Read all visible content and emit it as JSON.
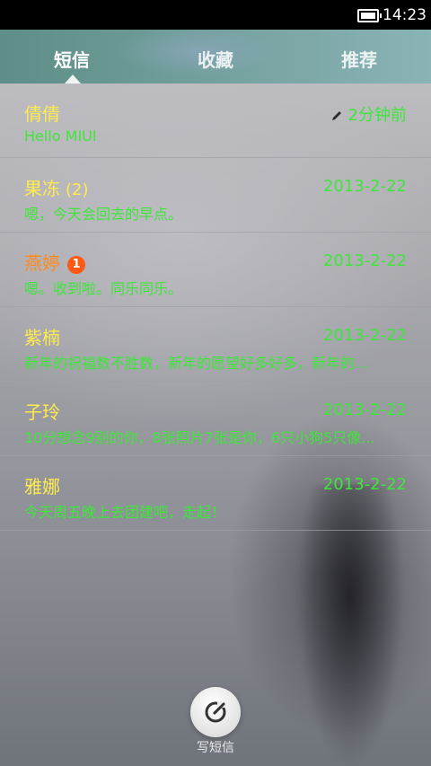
{
  "status_bar": {
    "time": "14:23"
  },
  "tabs": [
    {
      "label": "短信"
    },
    {
      "label": "收藏"
    },
    {
      "label": "推荐"
    }
  ],
  "messages": [
    {
      "name": "倩倩",
      "date": "2分钟前",
      "preview": "Hello MIUI"
    },
    {
      "name": "果冻",
      "count": "(2)",
      "date": "2013-2-22",
      "preview": "嗯，今天会回去的早点。"
    },
    {
      "name": "燕婷",
      "unread": "1",
      "date": "2013-2-22",
      "preview": "嗯。收到啦。同乐同乐。"
    },
    {
      "name": "紫楠",
      "date": "2013-2-22",
      "preview": "新年的祝福数不胜数，新年的愿望好多好多，新年的..."
    },
    {
      "name": "子玲",
      "date": "2013-2-22",
      "preview": "10分想念9别的你，8张照片7张是你，6只小狗5只像..."
    },
    {
      "name": "雅娜",
      "date": "2013-2-22",
      "preview": "今天周五晚上去团建吧，走起！"
    }
  ],
  "compose": {
    "label": "写短信",
    "icon": "compose-icon"
  },
  "colors": {
    "name": "#ffeb4f",
    "name_unread": "#ff8a1c",
    "green": "#3ee63a",
    "badge": "#ff5a14"
  }
}
